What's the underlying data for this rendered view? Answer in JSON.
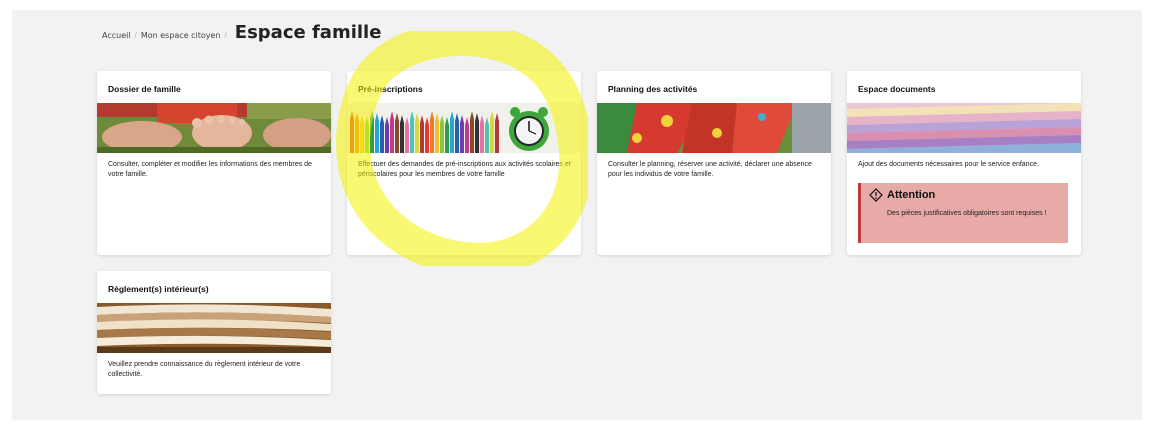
{
  "breadcrumb": {
    "home": "Accueil",
    "separator": "/",
    "parent": "Mon espace citoyen",
    "current": "Espace famille"
  },
  "cards": [
    {
      "title": "Dossier de famille",
      "text": "Consulter, compléter et modifier les informations des membres de votre famille."
    },
    {
      "title": "Pré-inscriptions",
      "text": "Effectuer des demandes de pré-inscriptions aux activités scolaires et périscolaires pour les membres de votre famille"
    },
    {
      "title": "Planning des activités",
      "text": "Consulter le planning, réserver une activité, déclarer une absence pour les individus de votre famille."
    },
    {
      "title": "Espace documents",
      "text": "Ajout des documents nécessaires pour le service enfance.",
      "alert": {
        "title": "Attention",
        "text": "Des pièces justificatives obligatoires sont requises !"
      }
    },
    {
      "title": "Règlement(s) intérieur(s)",
      "text": "Veuillez prendre connaissance du règlement intérieur de votre collectivité."
    }
  ],
  "colors": {
    "background": "#f2f2f2",
    "card": "#ffffff",
    "alert_bg": "#e8aaa6",
    "alert_border": "#c23a35",
    "highlight": "#f4f200"
  }
}
